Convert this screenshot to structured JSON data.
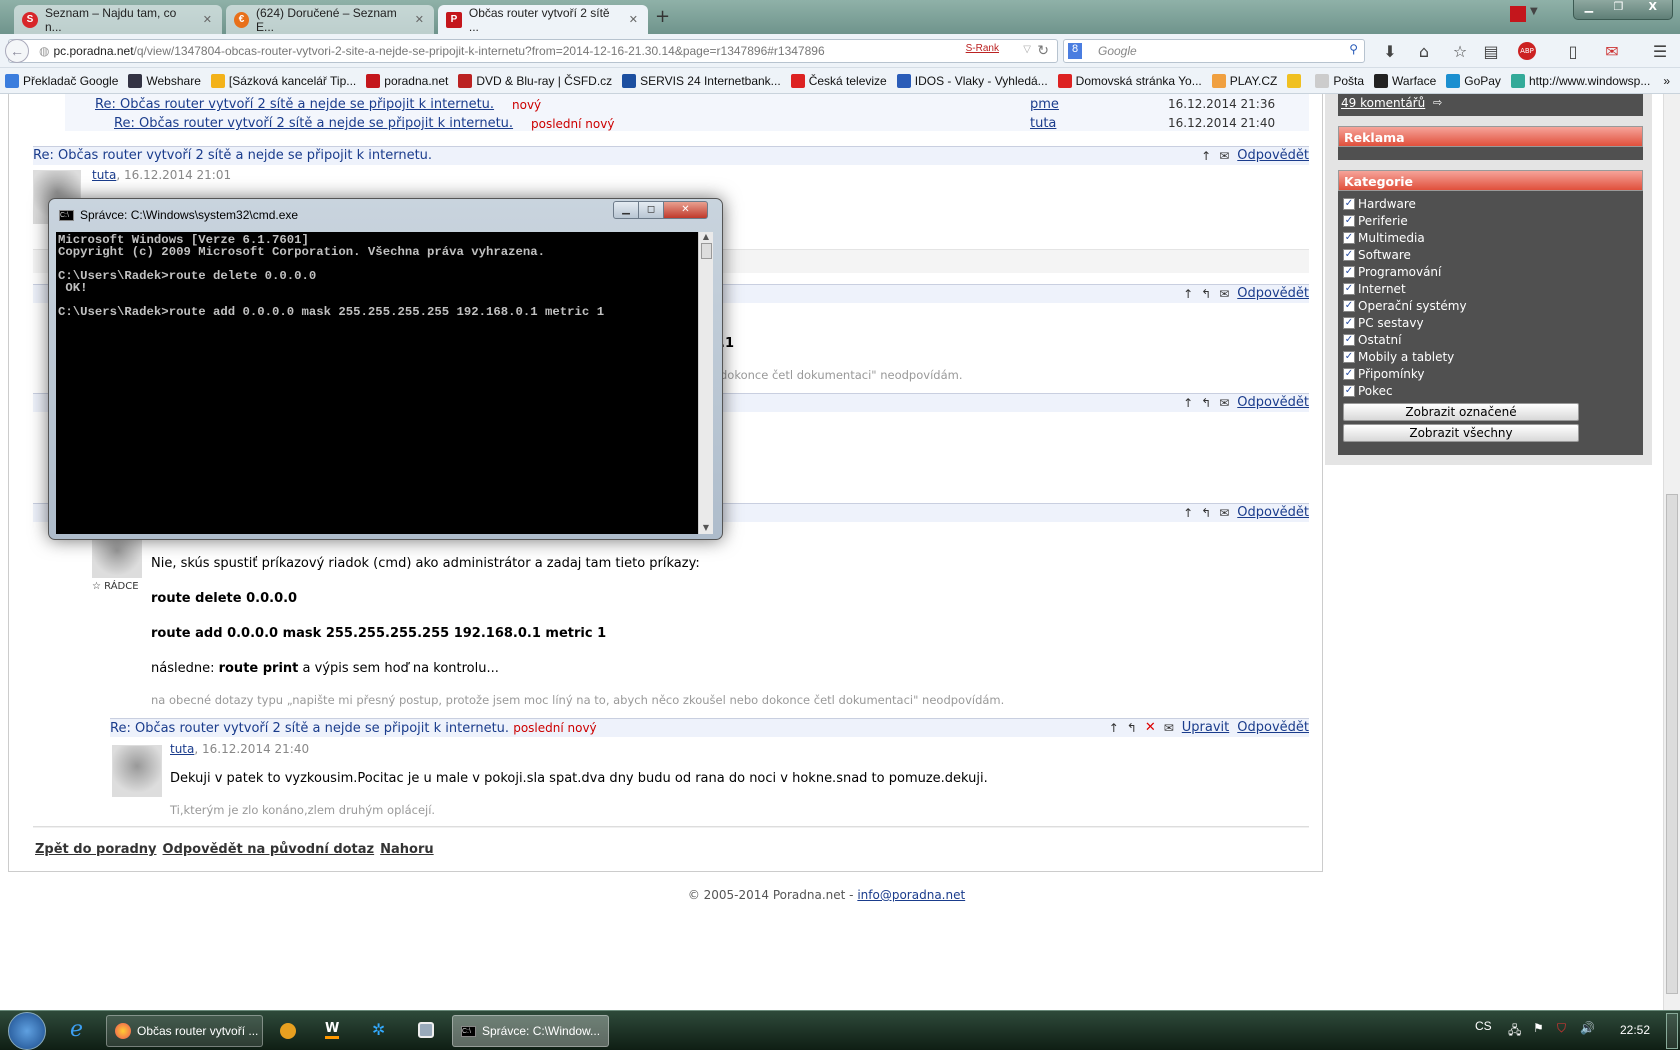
{
  "browser": {
    "tabs": [
      {
        "title": "Seznam – Najdu tam, co n...",
        "icon": "seznam-icon",
        "color": "#d8262a"
      },
      {
        "title": "(624) Doručené – Seznam E...",
        "icon": "email-icon",
        "color": "#e8701a"
      },
      {
        "title": "Občas router vytvoří 2 sítě ...",
        "icon": "poradna-icon",
        "color": "#c4161c"
      }
    ],
    "url_domain": "pc.poradna.net",
    "url_path": "/q/view/1347804-obcas-router-vytvori-2-site-a-nejde-se-pripojit-k-internetu?from=2014-12-16-21.30.14&page=r1347896#r1347896",
    "srank": "S-Rank",
    "search_placeholder": "Google",
    "bookmarks": [
      {
        "label": "Překladač Google",
        "color": "#3b7ddd"
      },
      {
        "label": "Webshare",
        "color": "#334"
      },
      {
        "label": "[Sázková kancelář Tip...",
        "color": "#f3b21a"
      },
      {
        "label": "poradna.net",
        "color": "#c4161c"
      },
      {
        "label": "DVD & Blu-ray | ČSFD.cz",
        "color": "#b22"
      },
      {
        "label": "SERVIS 24 Internetbank...",
        "color": "#1c4fa0"
      },
      {
        "label": "Česká televize",
        "color": "#d22"
      },
      {
        "label": "IDOS - Vlaky - Vyhledá...",
        "color": "#2a5cb8"
      },
      {
        "label": "Domovská stránka Yo...",
        "color": "#d22"
      },
      {
        "label": "PLAY.CZ",
        "color": "#f0a040"
      },
      {
        "label": "",
        "color": "#f0c020"
      },
      {
        "label": "Pošta",
        "color": "#ccc"
      },
      {
        "label": "Warface",
        "color": "#222"
      },
      {
        "label": "GoPay",
        "color": "#1b8fd0"
      },
      {
        "label": "http://www.windowsp...",
        "color": "#3a9"
      }
    ]
  },
  "thread_list": [
    {
      "title": "Re: Občas router vytvoří 2 sítě a nejde se připojit k internetu.",
      "badge": "nový",
      "author": "pme",
      "date": "16.12.2014 21:36"
    },
    {
      "title": "Re: Občas router vytvoří 2 sítě a nejde se připojit k internetu.",
      "badge": "poslední nový",
      "author": "tuta",
      "date": "16.12.2014 21:40"
    }
  ],
  "posts": {
    "p1": {
      "title": "Re: Občas router vytvoří 2 sítě a nejde se připojit k internetu.",
      "author": "tuta",
      "date": ", 16.12.2014 21:01",
      "reply": "Odpovědět"
    },
    "p2": {
      "reply": "Odpovědět",
      "partial_bold": ".1",
      "partial_sig": "dokonce četl dokumentaci\" neodpovídám."
    },
    "p3": {
      "reply": "Odpovědět"
    },
    "p4": {
      "reply": "Odpovědět",
      "rank": "RÁDCE",
      "intro": "Nie, skús spustiť príkazový riadok (cmd) ako administrátor a zadaj tam tieto príkazy:",
      "cmd1": "route delete 0.0.0.0",
      "cmd2": "route add 0.0.0.0 mask 255.255.255.255 192.168.0.1 metric 1",
      "then_prefix": "následne: ",
      "then_bold": "route print",
      "then_suffix": " a výpis sem hoď na kontrolu...",
      "sig": "na obecné dotazy typu „napište mi přesný postup, protože jsem moc líný na to, abych něco zkoušel nebo dokonce četl dokumentaci\" neodpovídám."
    },
    "p5": {
      "title": "Re: Občas router vytvoří 2 sítě a nejde se připojit k internetu.",
      "badge": "poslední nový",
      "edit": "Upravit",
      "reply": "Odpovědět",
      "author": "tuta",
      "date": ", 16.12.2014 21:40",
      "text": "Dekuji v patek to vyzkousim.Pocitac je u male v pokoji.sla spat.dva dny budu od rana do noci v hokne.snad to pomuze.dekuji.",
      "sig": "Ti,kterým je zlo konáno,zlem druhým oplácejí."
    }
  },
  "bottom_links": {
    "back": "Zpět do poradny",
    "reply_orig": "Odpovědět na původní dotaz",
    "top": "Nahoru"
  },
  "footer": {
    "copyright": "© 2005-2014 Poradna.net - ",
    "email": "info@poradna.net"
  },
  "sidebar": {
    "comments": "49 komentářů",
    "ad_title": "Reklama",
    "cat_title": "Kategorie",
    "categories": [
      "Hardware",
      "Periferie",
      "Multimedia",
      "Software",
      "Programování",
      "Internet",
      "Operační systémy",
      "PC sestavy",
      "Ostatní",
      "Mobily a tablety",
      "Připomínky",
      "Pokec"
    ],
    "show_selected": "Zobrazit označené",
    "show_all": "Zobrazit všechny"
  },
  "cmd": {
    "title": "Správce: C:\\Windows\\system32\\cmd.exe",
    "output": "Microsoft Windows [Verze 6.1.7601]\nCopyright (c) 2009 Microsoft Corporation. Všechna práva vyhrazena.\n\nC:\\Users\\Radek>route delete 0.0.0.0\n OK!\n\nC:\\Users\\Radek>route add 0.0.0.0 mask 255.255.255.255 192.168.0.1 metric 1"
  },
  "taskbar": {
    "firefox_task": "Občas router vytvoří ...",
    "cmd_task": "Správce: C:\\Window...",
    "lang": "CS",
    "time": "22:52"
  }
}
